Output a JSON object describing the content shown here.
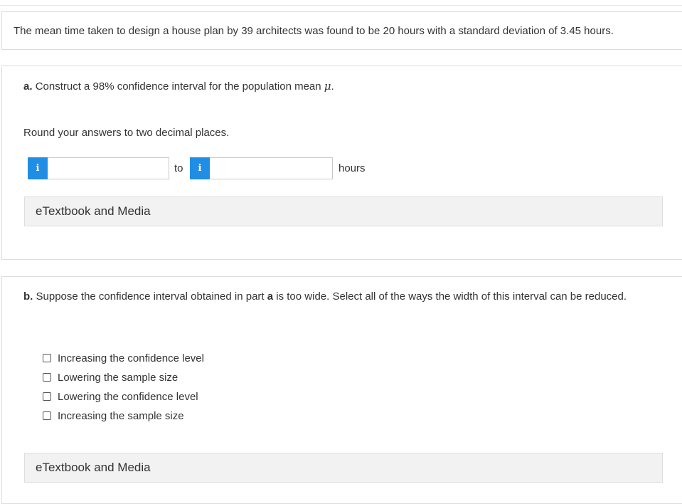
{
  "problem": {
    "text": "The mean time taken to design a house plan by 39 architects was found to be 20 hours with a standard deviation of 3.45 hours."
  },
  "part_a": {
    "label": "a.",
    "question": "Construct a 98% confidence interval for the population mean",
    "symbol": "μ",
    "period": ".",
    "instruction": "Round your answers to two decimal places.",
    "info_glyph": "i",
    "lower_value": "",
    "upper_value": "",
    "to_label": "to",
    "unit_label": "hours",
    "etextbook_label": "eTextbook and Media"
  },
  "part_b": {
    "label": "b.",
    "question_pre": "Suppose the confidence interval obtained in part",
    "question_part": "a",
    "question_post": "is too wide. Select all of the ways the width of this interval can be reduced.",
    "options": [
      "Increasing the confidence level",
      "Lowering the sample size",
      "Lowering the confidence level",
      "Increasing the sample size"
    ],
    "etextbook_label": "eTextbook and Media"
  },
  "colors": {
    "accent": "#1f8ee4",
    "text": "#333333",
    "border": "#dcdcdc",
    "etextbook_bg": "#f2f2f2"
  }
}
